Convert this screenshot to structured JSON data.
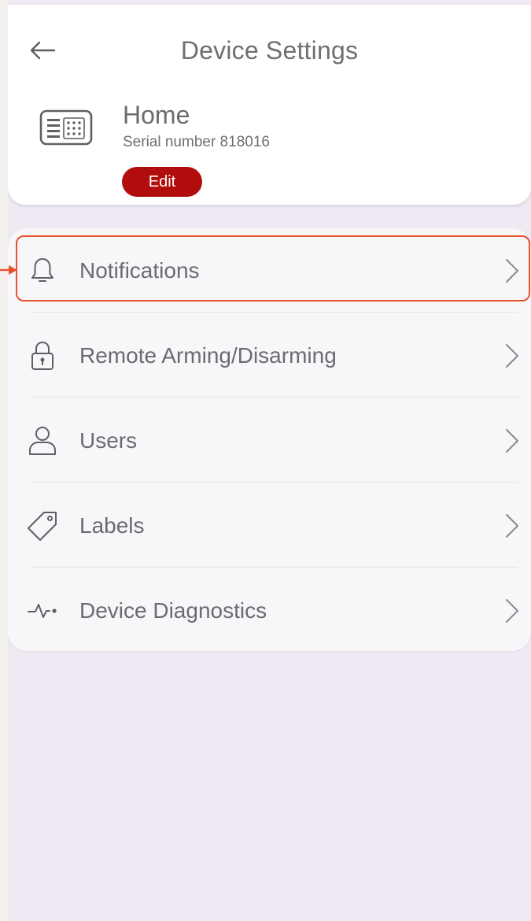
{
  "header": {
    "title": "Device Settings",
    "back_icon": "arrow-left-icon"
  },
  "device": {
    "icon": "keypad-icon",
    "name": "Home",
    "serial": "Serial number 818016",
    "edit_label": "Edit"
  },
  "menu": {
    "items": [
      {
        "label": "Notifications",
        "icon": "bell-icon",
        "highlighted": true
      },
      {
        "label": "Remote Arming/Disarming",
        "icon": "lock-icon"
      },
      {
        "label": "Users",
        "icon": "user-icon"
      },
      {
        "label": "Labels",
        "icon": "tag-icon"
      },
      {
        "label": "Device Diagnostics",
        "icon": "pulse-icon"
      }
    ]
  },
  "colors": {
    "accent": "#b20d0d",
    "highlight": "#e8502e",
    "background": "#efe9f3",
    "text": "#6b6b70"
  }
}
